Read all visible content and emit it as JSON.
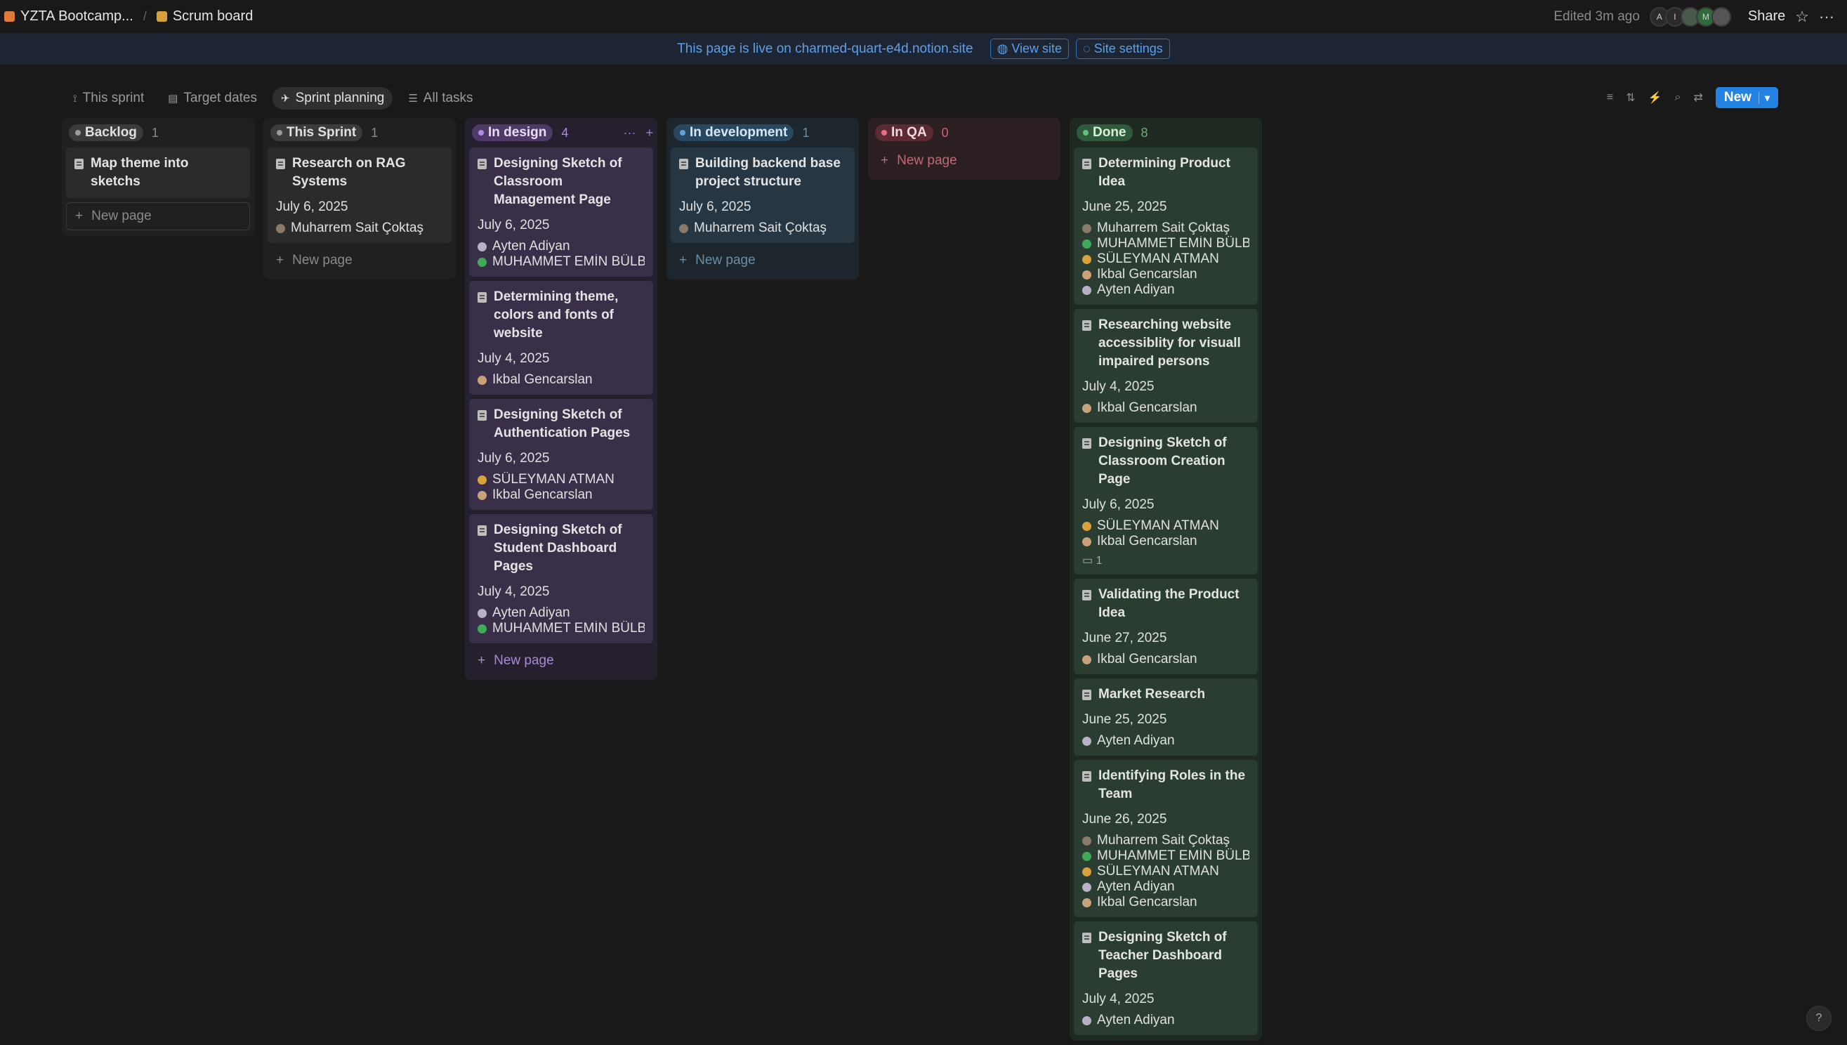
{
  "breadcrumb": {
    "workspace": "YZTA Bootcamp...",
    "page": "Scrum board",
    "workspace_icon_color": "#e07a3a",
    "page_icon_color": "#d7a13a"
  },
  "topbar": {
    "edited": "Edited 3m ago",
    "avatars": [
      "A",
      "I",
      "",
      "M",
      ""
    ],
    "share": "Share"
  },
  "banner": {
    "text": "This page is live on charmed-quart-e4d.notion.site",
    "view_site": "View site",
    "site_settings": "Site settings"
  },
  "view_tabs": [
    {
      "label": "This sprint",
      "icon": "chart-icon"
    },
    {
      "label": "Target dates",
      "icon": "calendar-icon"
    },
    {
      "label": "Sprint planning",
      "icon": "plane-icon"
    },
    {
      "label": "All tasks",
      "icon": "list-icon"
    }
  ],
  "toolbar": {
    "new_label": "New"
  },
  "new_page_label": "New page",
  "columns": [
    {
      "name": "Backlog",
      "count": "1",
      "cards": [
        {
          "title": "Map theme into sketchs",
          "date": "",
          "people": []
        }
      ]
    },
    {
      "name": "This Sprint",
      "count": "1",
      "cards": [
        {
          "title": "Research on RAG Systems",
          "date": "July 6, 2025",
          "people": [
            "Muharrem Sait Çoktaş"
          ]
        }
      ]
    },
    {
      "name": "In design",
      "count": "4",
      "cards": [
        {
          "title": "Designing Sketch of Classroom Management Page",
          "date": "July 6, 2025",
          "people": [
            "Ayten Adiyan",
            "MUHAMMET EMİN BÜLBÜ"
          ]
        },
        {
          "title": "Determining theme, colors and fonts of website",
          "date": "July 4, 2025",
          "people": [
            "Ikbal Gencarslan"
          ]
        },
        {
          "title": "Designing Sketch of Authentication Pages",
          "date": "July 6, 2025",
          "people": [
            "SÜLEYMAN ATMAN",
            "Ikbal Gencarslan"
          ]
        },
        {
          "title": "Designing Sketch of Student Dashboard Pages",
          "date": "July 4, 2025",
          "people": [
            "Ayten Adiyan",
            "MUHAMMET EMİN BÜLBÜ"
          ]
        }
      ]
    },
    {
      "name": "In development",
      "count": "1",
      "cards": [
        {
          "title": "Building backend base project structure",
          "date": "July 6, 2025",
          "people": [
            "Muharrem Sait Çoktaş"
          ]
        }
      ]
    },
    {
      "name": "In QA",
      "count": "0",
      "cards": []
    },
    {
      "name": "Done",
      "count": "8",
      "cards": [
        {
          "title": "Determining Product Idea",
          "date": "June 25, 2025",
          "people": [
            "Muharrem Sait Çoktaş",
            "MUHAMMET EMİN BÜLBÜ",
            "SÜLEYMAN ATMAN",
            "Ikbal Gencarslan",
            "Ayten Adiyan"
          ]
        },
        {
          "title": "Researching website accessiblity for visuall impaired persons",
          "date": "July 4, 2025",
          "people": [
            "Ikbal Gencarslan"
          ]
        },
        {
          "title": "Designing Sketch of Classroom Creation Page",
          "date": "July 6, 2025",
          "people": [
            "SÜLEYMAN ATMAN",
            "Ikbal Gencarslan"
          ],
          "comments": "1"
        },
        {
          "title": "Validating the Product Idea",
          "date": "June 27, 2025",
          "people": [
            "Ikbal Gencarslan"
          ]
        },
        {
          "title": "Market Research",
          "date": "June 25, 2025",
          "people": [
            "Ayten Adiyan"
          ]
        },
        {
          "title": "Identifying Roles in the Team",
          "date": "June 26, 2025",
          "people": [
            "Muharrem Sait Çoktaş",
            "MUHAMMET EMİN BÜLBÜ",
            "SÜLEYMAN ATMAN",
            "Ayten Adiyan",
            "Ikbal Gencarslan"
          ]
        },
        {
          "title": "Designing Sketch of Teacher Dashboard Pages",
          "date": "July 4, 2025",
          "people": [
            "Ayten Adiyan"
          ]
        }
      ]
    }
  ],
  "help": "?"
}
